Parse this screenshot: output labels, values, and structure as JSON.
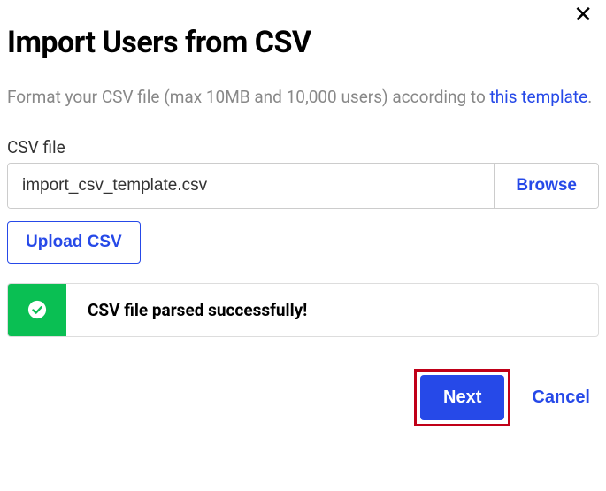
{
  "dialog": {
    "title": "Import Users from CSV",
    "description_prefix": "Format your CSV file (max 10MB and 10,000 users) according to ",
    "description_link": "this template",
    "description_suffix": "."
  },
  "file_field": {
    "label": "CSV file",
    "value": "import_csv_template.csv",
    "browse_label": "Browse"
  },
  "upload": {
    "label": "Upload CSV"
  },
  "status": {
    "message": "CSV file parsed successfully!",
    "type": "success",
    "color": "#0abf53"
  },
  "actions": {
    "next_label": "Next",
    "cancel_label": "Cancel"
  }
}
